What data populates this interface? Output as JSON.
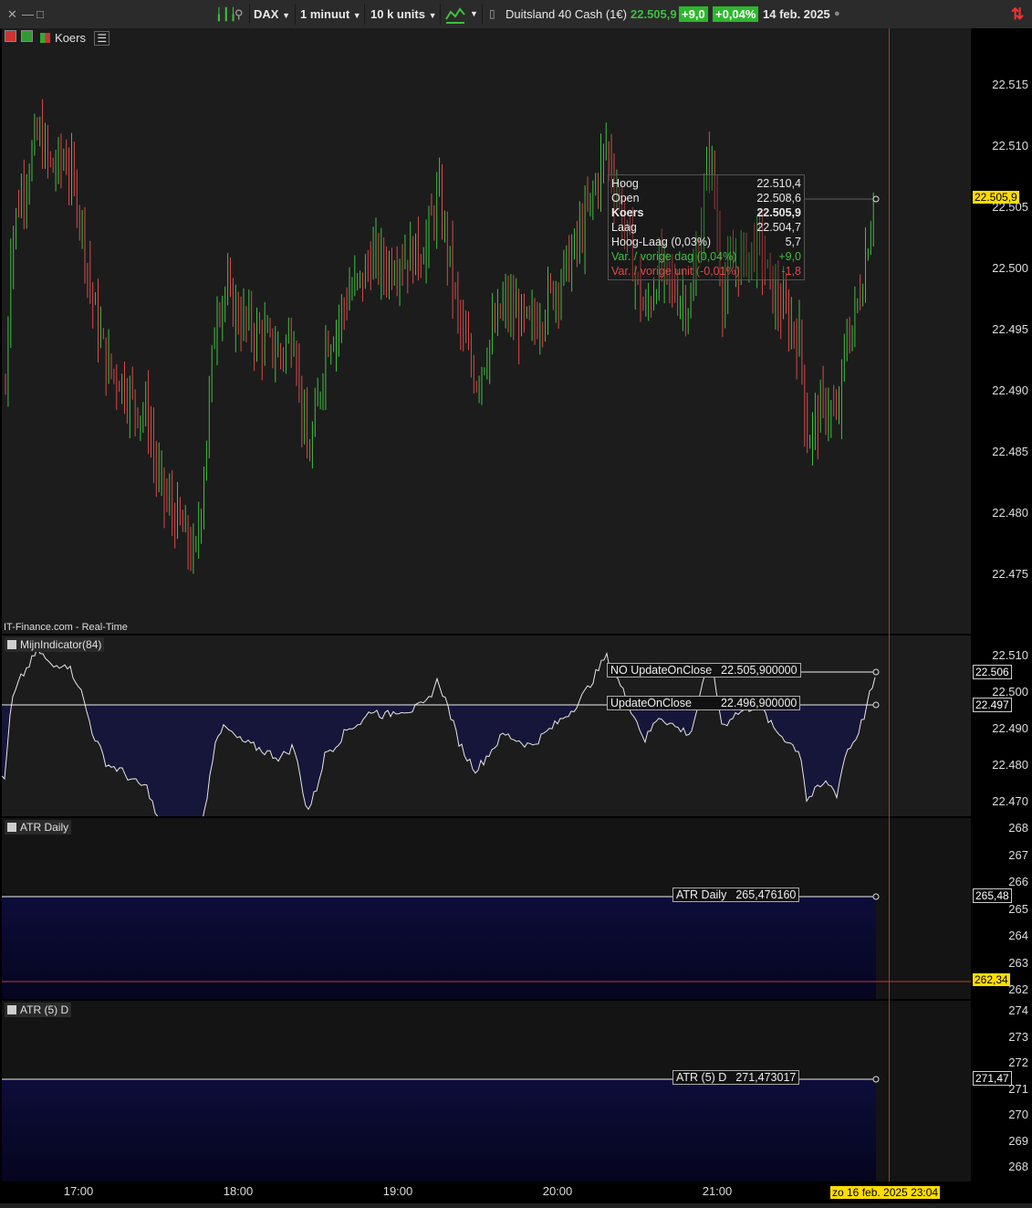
{
  "toolbar": {
    "instrument": "DAX",
    "timeframe": "1 minuut",
    "units": "10 k units",
    "product_name": "Duitsland 40 Cash (1€)",
    "last_price": "22.505,9",
    "change": "+9,0",
    "change_pct": "+0,04%",
    "date": "14 feb. 2025",
    "icons": [
      "close-icon",
      "minimize-icon",
      "maximize-icon",
      "candles-icon",
      "sync-icon",
      "chart-style-icon",
      "refresh-icon"
    ]
  },
  "price_panel": {
    "title": "Koers",
    "source": "IT-Finance.com - Real-Time",
    "current_tag": "22.505,9",
    "axis_labels": [
      "22.515",
      "22.510",
      "22.505",
      "22.500",
      "22.495",
      "22.490",
      "22.485",
      "22.480",
      "22.475"
    ],
    "tooltip": {
      "rows": [
        {
          "k": "Hoog",
          "v": "22.510,4",
          "style": "normal"
        },
        {
          "k": "Open",
          "v": "22.508,6",
          "style": "normal"
        },
        {
          "k": "Koers",
          "v": "22.505,9",
          "style": "bold"
        },
        {
          "k": "Laag",
          "v": "22.504,7",
          "style": "normal"
        },
        {
          "k": "Hoog-Laag (0,03%)",
          "v": "5,7",
          "style": "normal"
        },
        {
          "k": "Var. / vorige dag (0,04%)",
          "v": "+9,0",
          "style": "green"
        },
        {
          "k": "Var. / vorige unit (-0,01%)",
          "v": "-1,8",
          "style": "red"
        }
      ]
    }
  },
  "indicator_panel": {
    "title": "MijnIndicator(84)",
    "label_no_update": "NO UpdateOnClose",
    "value_no_update": "22.505,900000",
    "label_update": "UpdateOnClose",
    "value_update": "22.496,900000",
    "axis_labels": [
      "22.510",
      "22.500",
      "22.490",
      "22.480",
      "22.470"
    ],
    "tag_top": "22.506",
    "tag_bottom": "22.497"
  },
  "atr_daily_panel": {
    "title": "ATR Daily",
    "label": "ATR Daily",
    "value": "265,476160",
    "axis_labels": [
      "268",
      "267",
      "266",
      "265",
      "264",
      "263",
      "262"
    ],
    "tag": "265,48",
    "cursor_tag": "262,34"
  },
  "atr5_panel": {
    "title": "ATR (5) D",
    "label": "ATR (5) D",
    "value": "271,473017",
    "axis_labels": [
      "274",
      "273",
      "272",
      "271",
      "270",
      "269",
      "268"
    ],
    "tag": "271,47"
  },
  "time_axis": {
    "labels": [
      "17:00",
      "18:00",
      "19:00",
      "20:00",
      "21:00"
    ],
    "cursor_date": "zo 16 feb. 2025 23:04"
  },
  "colors": {
    "up": "#3fbf3f",
    "down": "#d94a4a",
    "highlight": "#ffdd00",
    "positive_bg": "#2db82d",
    "fill": "#0d0d3a"
  }
}
